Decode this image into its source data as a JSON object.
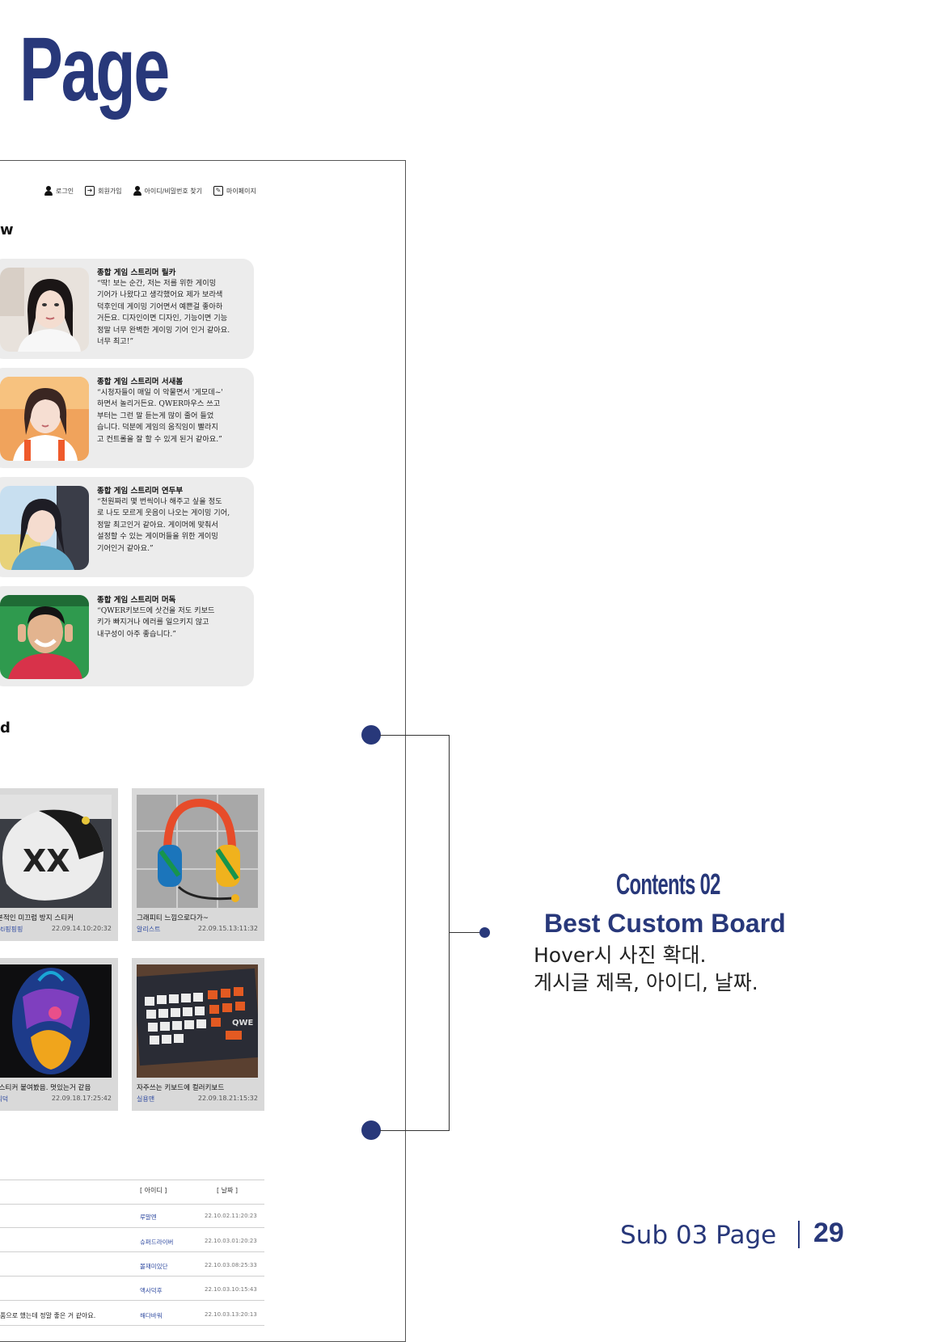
{
  "page_heading": "Page",
  "nav": {
    "login": "로그인",
    "signup": "회원가입",
    "find": "아이디/비밀번호 찾기",
    "mypage": "마이페이지"
  },
  "sections": {
    "review_title_fragment": "w",
    "board_title_fragment": "d"
  },
  "reviews": [
    {
      "name": "종합 게임 스트리머 릴카",
      "text": "“딱! 보는 순간, 저는 저를 위한 게이밍\n기어가 나왔다고 생각했어요 제가 보라색\n덕후인데 게이밍 기어면서 예쁜걸 좋아하\n거든요. 디자인이면 디자인, 기능이면 기능\n정말 너무 완벽한 게이밍 기어 인거 같아요.\n너무 최고!”"
    },
    {
      "name": "종합 게임 스트리머 서새봄",
      "text": "“시청자들이 매일 이 악물면서 '게모데~'\n하면서 놀리거든요. QWER마우스 쓰고\n부터는 그런 말 듣는게 많이 줄어 들었\n습니다. 덕분에 게임의 움직임이 빨라지\n고 컨트롤을 잘 할 수 있게 된거 같아요.”"
    },
    {
      "name": "종합 게임 스트리머 연두부",
      "text": "“천원짜리 몇 번씩이나 해주고 싶을 정도\n로 나도 모르게 웃음이 나오는 게이밍 기어,\n정말 최고인거 같아요. 게이머에 맞춰서\n설정할 수 있는 게이머들을 위한 게이밍\n기어인거 같아요.”"
    },
    {
      "name": "종합 게임 스트리머 머독",
      "text": "“QWER키보드에 삿건을 저도 키보드\n키가 빠지거나 에러를 일으키지 않고\n내구성이 아주 좋습니다.”"
    }
  ],
  "gallery": [
    {
      "title": "이본적인 미끄럼 방지 스티커",
      "user": "mbti핑핑핑",
      "date": "22.09.14.10:20:32"
    },
    {
      "title": "그래피티 느낌으로다가~",
      "user": "알리스트",
      "date": "22.09.15.13:11:32"
    },
    {
      "title": "칼 스티커 붙여봤음. 멋있는거 같음",
      "user": "중의덕",
      "date": "22.09.18.17:25:42"
    },
    {
      "title": "자주쓰는 키보드에 컬러키보드",
      "user": "실용맨",
      "date": "22.09.18.21:15:32"
    }
  ],
  "list": {
    "col_id": "[ 아이디 ]",
    "col_date": "[ 날짜 ]",
    "rows": [
      {
        "title": "",
        "user": "루말멘",
        "date": "22.10.02.11:20:23"
      },
      {
        "title": "",
        "user": "슈퍼드라이버",
        "date": "22.10.03.01:20:23"
      },
      {
        "title": "",
        "user": "볼재미있단",
        "date": "22.10.03.08:25:33"
      },
      {
        "title": "",
        "user": "액사덕후",
        "date": "22.10.03.10:15:43"
      },
      {
        "title": "품으로 했는데 정말 좋은 거 같아요.",
        "user": "해다바워",
        "date": "22.10.03.13:20:13"
      }
    ]
  },
  "contents": {
    "label": "Contents 02",
    "heading": "Best Custom Board",
    "desc_line1": "Hover시 사진 확대.",
    "desc_line2": "게시글 제목, 아이디, 날짜."
  },
  "footer": {
    "label": "Sub 03 Page",
    "page_number": "29"
  },
  "colors": {
    "accent": "#28387a",
    "card_bg": "#ececec",
    "gallery_bg": "#d9d9d9"
  }
}
